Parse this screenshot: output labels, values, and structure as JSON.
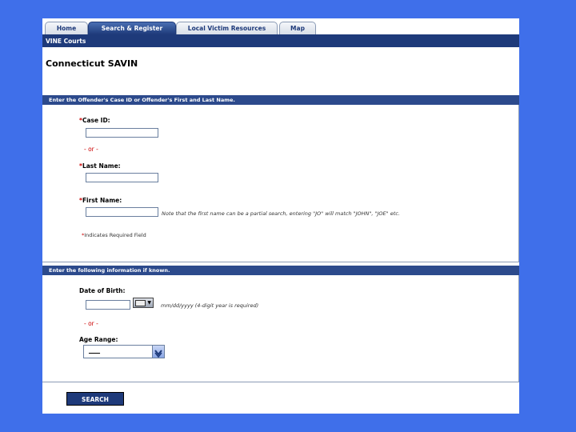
{
  "tabs": [
    {
      "label": "Home",
      "active": false
    },
    {
      "label": "Search & Register",
      "active": true
    },
    {
      "label": "Local Victim Resources",
      "active": false
    },
    {
      "label": "Map",
      "active": false
    }
  ],
  "subnav": {
    "label": "VINE Courts"
  },
  "page_title": "Connecticut SAVIN",
  "section1": {
    "header": "Enter the Offender's Case ID or Offender's First and Last Name.",
    "case_id_label": "Case ID:",
    "or_text": "- or -",
    "last_name_label": "Last Name:",
    "first_name_label": "First Name:",
    "first_name_note": "Note that the first name can be a partial search, entering \"JO\" will match \"JOHN\", \"JOE\" etc.",
    "required_text": "Indicates Required Field",
    "required_mark": "*"
  },
  "section2": {
    "header": "Enter the following information if known.",
    "dob_label": "Date of Birth:",
    "dob_format": "mm/dd/yyyy (4-digit year is required)",
    "or_text": "- or -",
    "age_label": "Age Range:",
    "age_selected": "____"
  },
  "search_button": {
    "label": "SEARCH"
  },
  "colors": {
    "background": "#3f6fea",
    "nav": "#1e3a7a",
    "section_bar": "#2c4a8c",
    "required": "#cc0000"
  }
}
